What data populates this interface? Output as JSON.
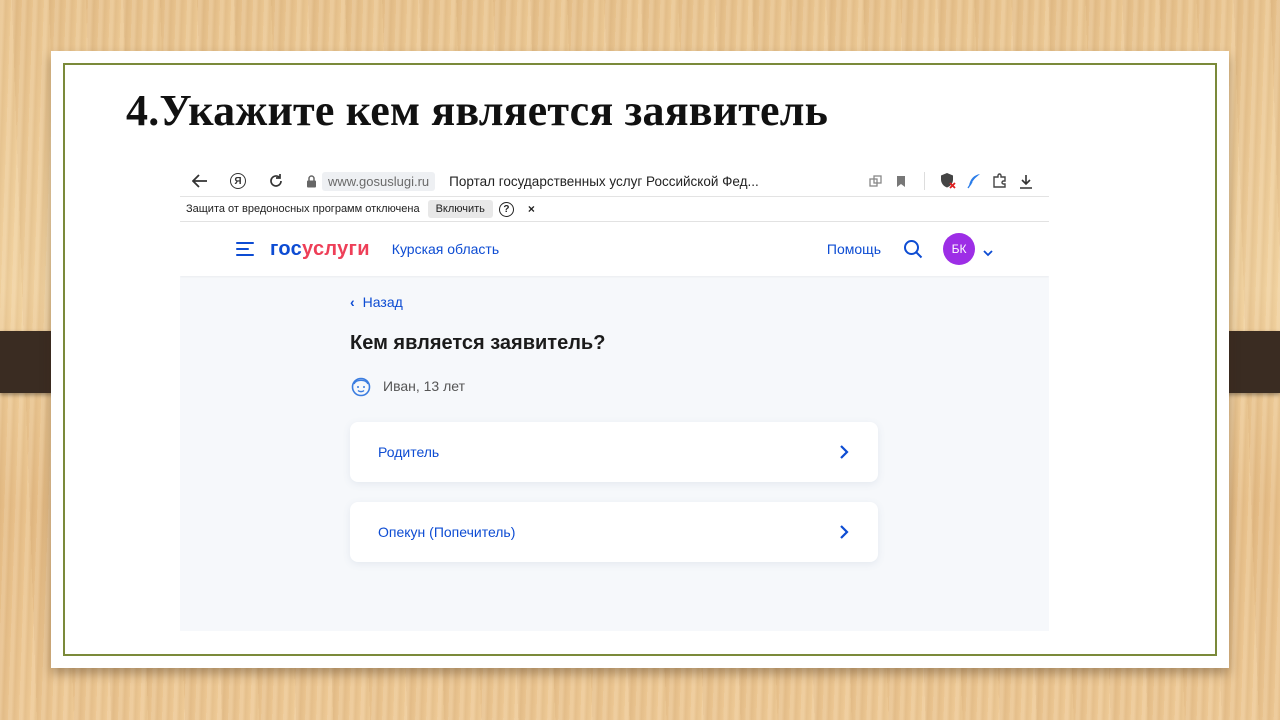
{
  "slide": {
    "title": "4.Укажите кем является заявитель"
  },
  "browser": {
    "url": "www.gosuslugi.ru",
    "tab_title": "Портал государственных услуг Российской Фед...",
    "ya_label": "Я",
    "warning": {
      "text": "Защита от вредоносных программ отключена",
      "enable_label": "Включить",
      "help_label": "?",
      "close_label": "×"
    }
  },
  "site": {
    "logo_gos": "гос",
    "logo_usl": "услуги",
    "region": "Курская область",
    "help": "Помощь",
    "avatar_initials": "БК",
    "colors": {
      "accent": "#0d4cd3",
      "logo_red": "#ee3f58",
      "avatar": "#9d2ee6"
    }
  },
  "page": {
    "back_label": "Назад",
    "question": "Кем является заявитель?",
    "child": "Иван, 13 лет",
    "options": [
      {
        "label": "Родитель"
      },
      {
        "label": "Опекун (Попечитель)"
      }
    ]
  }
}
